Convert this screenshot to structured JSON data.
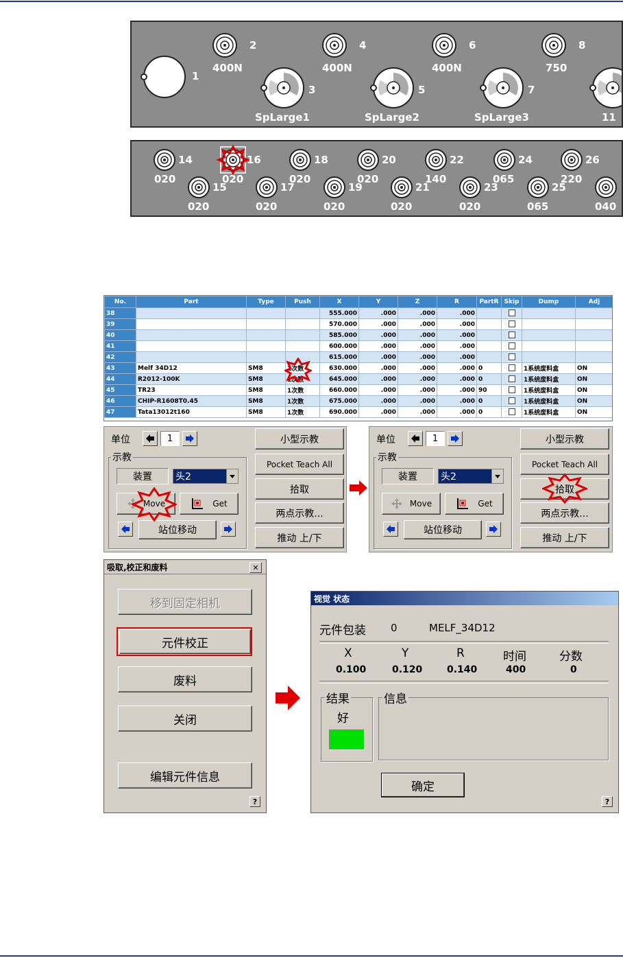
{
  "feeder_top": {
    "items": [
      {
        "num": "1",
        "name": ""
      },
      {
        "num": "2",
        "name": "400N"
      },
      {
        "num": "3",
        "name": "SpLarge1"
      },
      {
        "num": "4",
        "name": "400N"
      },
      {
        "num": "5",
        "name": "SpLarge2"
      },
      {
        "num": "6",
        "name": "400N"
      },
      {
        "num": "7",
        "name": "SpLarge3"
      },
      {
        "num": "8",
        "name": "750"
      },
      {
        "num": "",
        "name": "11"
      }
    ]
  },
  "feeder_bottom": {
    "items": [
      {
        "num": "14",
        "name": "020"
      },
      {
        "num": "15",
        "name": "020"
      },
      {
        "num": "16",
        "name": "020"
      },
      {
        "num": "17",
        "name": "020"
      },
      {
        "num": "18",
        "name": "020"
      },
      {
        "num": "19",
        "name": "020"
      },
      {
        "num": "20",
        "name": "020"
      },
      {
        "num": "21",
        "name": "020"
      },
      {
        "num": "22",
        "name": "140"
      },
      {
        "num": "23",
        "name": "020"
      },
      {
        "num": "24",
        "name": "065"
      },
      {
        "num": "25",
        "name": "065"
      },
      {
        "num": "26",
        "name": "220"
      },
      {
        "num": "",
        "name": "040"
      }
    ]
  },
  "table": {
    "headers": [
      "No.",
      "Part",
      "Type",
      "Push",
      "X",
      "Y",
      "Z",
      "R",
      "PartR",
      "Skip",
      "Dump",
      "Adj"
    ],
    "rows": [
      [
        "38",
        "",
        "",
        "",
        "555.000",
        ".000",
        ".000",
        ".000",
        "",
        "",
        "",
        ""
      ],
      [
        "39",
        "",
        "",
        "",
        "570.000",
        ".000",
        ".000",
        ".000",
        "",
        "",
        "",
        ""
      ],
      [
        "40",
        "",
        "",
        "",
        "585.000",
        ".000",
        ".000",
        ".000",
        "",
        "",
        "",
        ""
      ],
      [
        "41",
        "",
        "",
        "",
        "600.000",
        ".000",
        ".000",
        ".000",
        "",
        "",
        "",
        ""
      ],
      [
        "42",
        "",
        "",
        "",
        "615.000",
        ".000",
        ".000",
        ".000",
        "",
        "",
        "",
        ""
      ],
      [
        "43",
        "Melf 34D12",
        "SM8",
        "1次数",
        "630.000",
        ".000",
        ".000",
        ".000",
        "0",
        "",
        "1系统废料盒",
        "ON"
      ],
      [
        "44",
        "R2012-100K",
        "SM8",
        "1次数",
        "645.000",
        ".000",
        ".000",
        ".000",
        "0",
        "",
        "1系统废料盒",
        "ON"
      ],
      [
        "45",
        "TR23",
        "SM8",
        "1次数",
        "660.000",
        ".000",
        ".000",
        ".000",
        "90",
        "",
        "1系统废料盒",
        "ON"
      ],
      [
        "46",
        "CHIP-R1608T0.45",
        "SM8",
        "1次数",
        "675.000",
        ".000",
        ".000",
        ".000",
        "0",
        "",
        "1系统废料盒",
        "ON"
      ],
      [
        "47",
        "Tata13012t160",
        "SM8",
        "1次数",
        "690.000",
        ".000",
        ".000",
        ".000",
        "0",
        "",
        "1系统废料盒",
        "ON"
      ]
    ]
  },
  "teach": {
    "unit_label": "单位",
    "unit_value": "1",
    "group_label": "示教",
    "device_label": "装置",
    "head_value": "头2",
    "move_label": "Move",
    "get_label": "Get",
    "station_move": "站位移动",
    "small_teach": "小型示教",
    "pocket_teach_all": "Pocket Teach All",
    "pick": "拾取",
    "two_point": "两点示教...",
    "push_updown": "推动 上/下"
  },
  "pick_dialog": {
    "title": "吸取,校正和废料",
    "close": "✕",
    "move_camera": "移到固定相机",
    "calibrate": "元件校正",
    "waste": "废料",
    "close_btn": "关闭",
    "edit_info": "编辑元件信息",
    "help": "?"
  },
  "vision_dialog": {
    "title": "视觉 状态",
    "pkg_label": "元件包装",
    "pkg_num": "0",
    "pkg_name": "MELF_34D12",
    "cols": [
      "X",
      "Y",
      "R",
      "时间",
      "分数"
    ],
    "vals": [
      "0.100",
      "0.120",
      "0.140",
      "400",
      "0"
    ],
    "result_label": "结果",
    "result_value": "好",
    "info_label": "信息",
    "ok": "确定",
    "help": "?",
    "result_color": "#00e000"
  },
  "colors": {
    "header_blue": "#3c86c8",
    "title_bar": "#0a246a",
    "highlight_red": "#e00000"
  }
}
